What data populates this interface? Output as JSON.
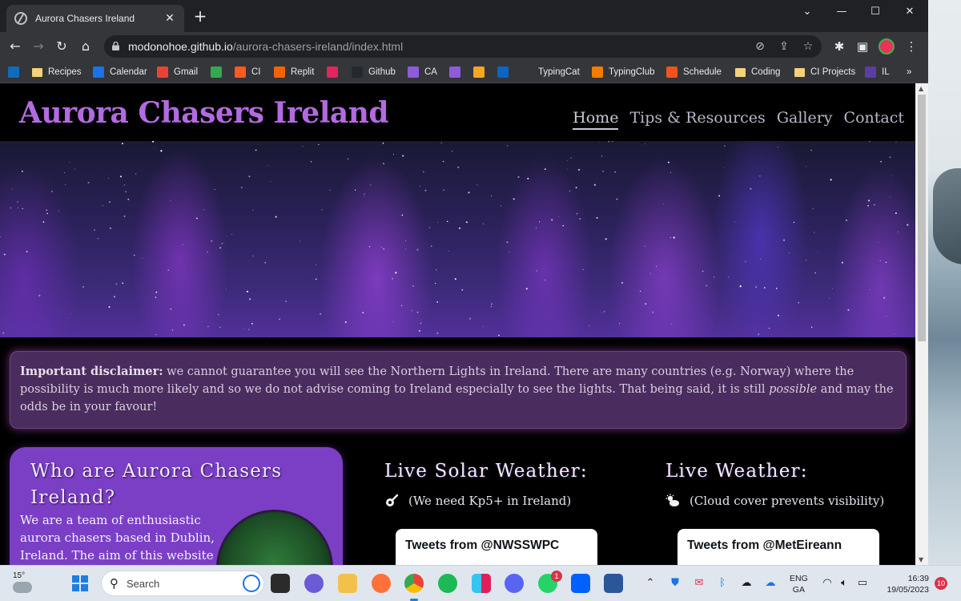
{
  "browser": {
    "tab_title": "Aurora Chasers Ireland",
    "new_tab": "+",
    "window_controls": {
      "minimize": "⌄",
      "min": "—",
      "max": "☐",
      "close": "✕"
    },
    "url_host": "modonohoe.github.io",
    "url_path": "/aurora-chasers-ireland/index.html",
    "bookmarks": [
      {
        "label": "",
        "icon": "outlook-icon",
        "color": "#0f6cbd"
      },
      {
        "label": "Recipes",
        "icon": "folder-icon",
        "color": "#f2d27a"
      },
      {
        "label": "Calendar",
        "icon": "calendar-icon",
        "color": "#1a73e8"
      },
      {
        "label": "Gmail",
        "icon": "gmail-icon",
        "color": "#ea4335"
      },
      {
        "label": "",
        "icon": "drive-icon",
        "color": "#34a853"
      },
      {
        "label": "CI",
        "icon": "ci-icon",
        "color": "#ff5a1f"
      },
      {
        "label": "Replit",
        "icon": "replit-icon",
        "color": "#f26207"
      },
      {
        "label": "",
        "icon": "m-icon",
        "color": "#e2245f"
      },
      {
        "label": "Github",
        "icon": "github-icon",
        "color": "#24292f"
      },
      {
        "label": "CA",
        "icon": "ca-icon",
        "color": "#8e5cd9"
      },
      {
        "label": "",
        "icon": "cube-icon",
        "color": "#8e5cd9"
      },
      {
        "label": "",
        "icon": "g-icon",
        "color": "#f5a623"
      },
      {
        "label": "",
        "icon": "linkedin-icon",
        "color": "#0a66c2"
      },
      {
        "label": "TypingCat",
        "icon": "",
        "color": ""
      },
      {
        "label": "TypingClub",
        "icon": "typingclub-icon",
        "color": "#f57c00"
      },
      {
        "label": "Schedule",
        "icon": "schedule-icon",
        "color": "#f4511e"
      },
      {
        "label": "Coding",
        "icon": "folder-icon",
        "color": "#f2d27a"
      },
      {
        "label": "CI Projects",
        "icon": "folder-icon",
        "color": "#f2d27a"
      },
      {
        "label": "IL",
        "icon": "il-icon",
        "color": "#5b3fa0"
      }
    ],
    "bookmarks_more": "»"
  },
  "site": {
    "title": "Aurora Chasers Ireland",
    "nav": [
      {
        "label": "Home",
        "active": true
      },
      {
        "label": "Tips & Resources",
        "active": false
      },
      {
        "label": "Gallery",
        "active": false
      },
      {
        "label": "Contact",
        "active": false
      }
    ],
    "disclaimer": {
      "bold": "Important disclaimer:",
      "text1": " we cannot guarantee you will see the Northern Lights in Ireland. There are many countries (e.g. Norway) where the possibility is much more likely and so we do not advise coming to Ireland especially to see the lights. That being said, it is still ",
      "italic": "possible",
      "text2": " and may the odds be in your favour!"
    },
    "who": {
      "title": "Who are Aurora Chasers Ireland?",
      "text": "We are a team of enthusiastic aurora chasers based in Dublin, Ireland. The aim of this website is"
    },
    "solar": {
      "title": "Live Solar Weather:",
      "note": "(We need Kp5+ in Ireland)",
      "tweets_title": "Tweets from @NWSSWPC"
    },
    "weather": {
      "title": "Live Weather:",
      "note": "(Cloud cover prevents visibility)",
      "tweets_title": "Tweets from @MetEireann"
    }
  },
  "taskbar": {
    "temperature": "15°",
    "search_placeholder": "Search",
    "whatsapp_badge": "1",
    "lang_line1": "ENG",
    "lang_line2": "GA",
    "time": "16:39",
    "date": "19/05/2023",
    "notifications": "10"
  }
}
